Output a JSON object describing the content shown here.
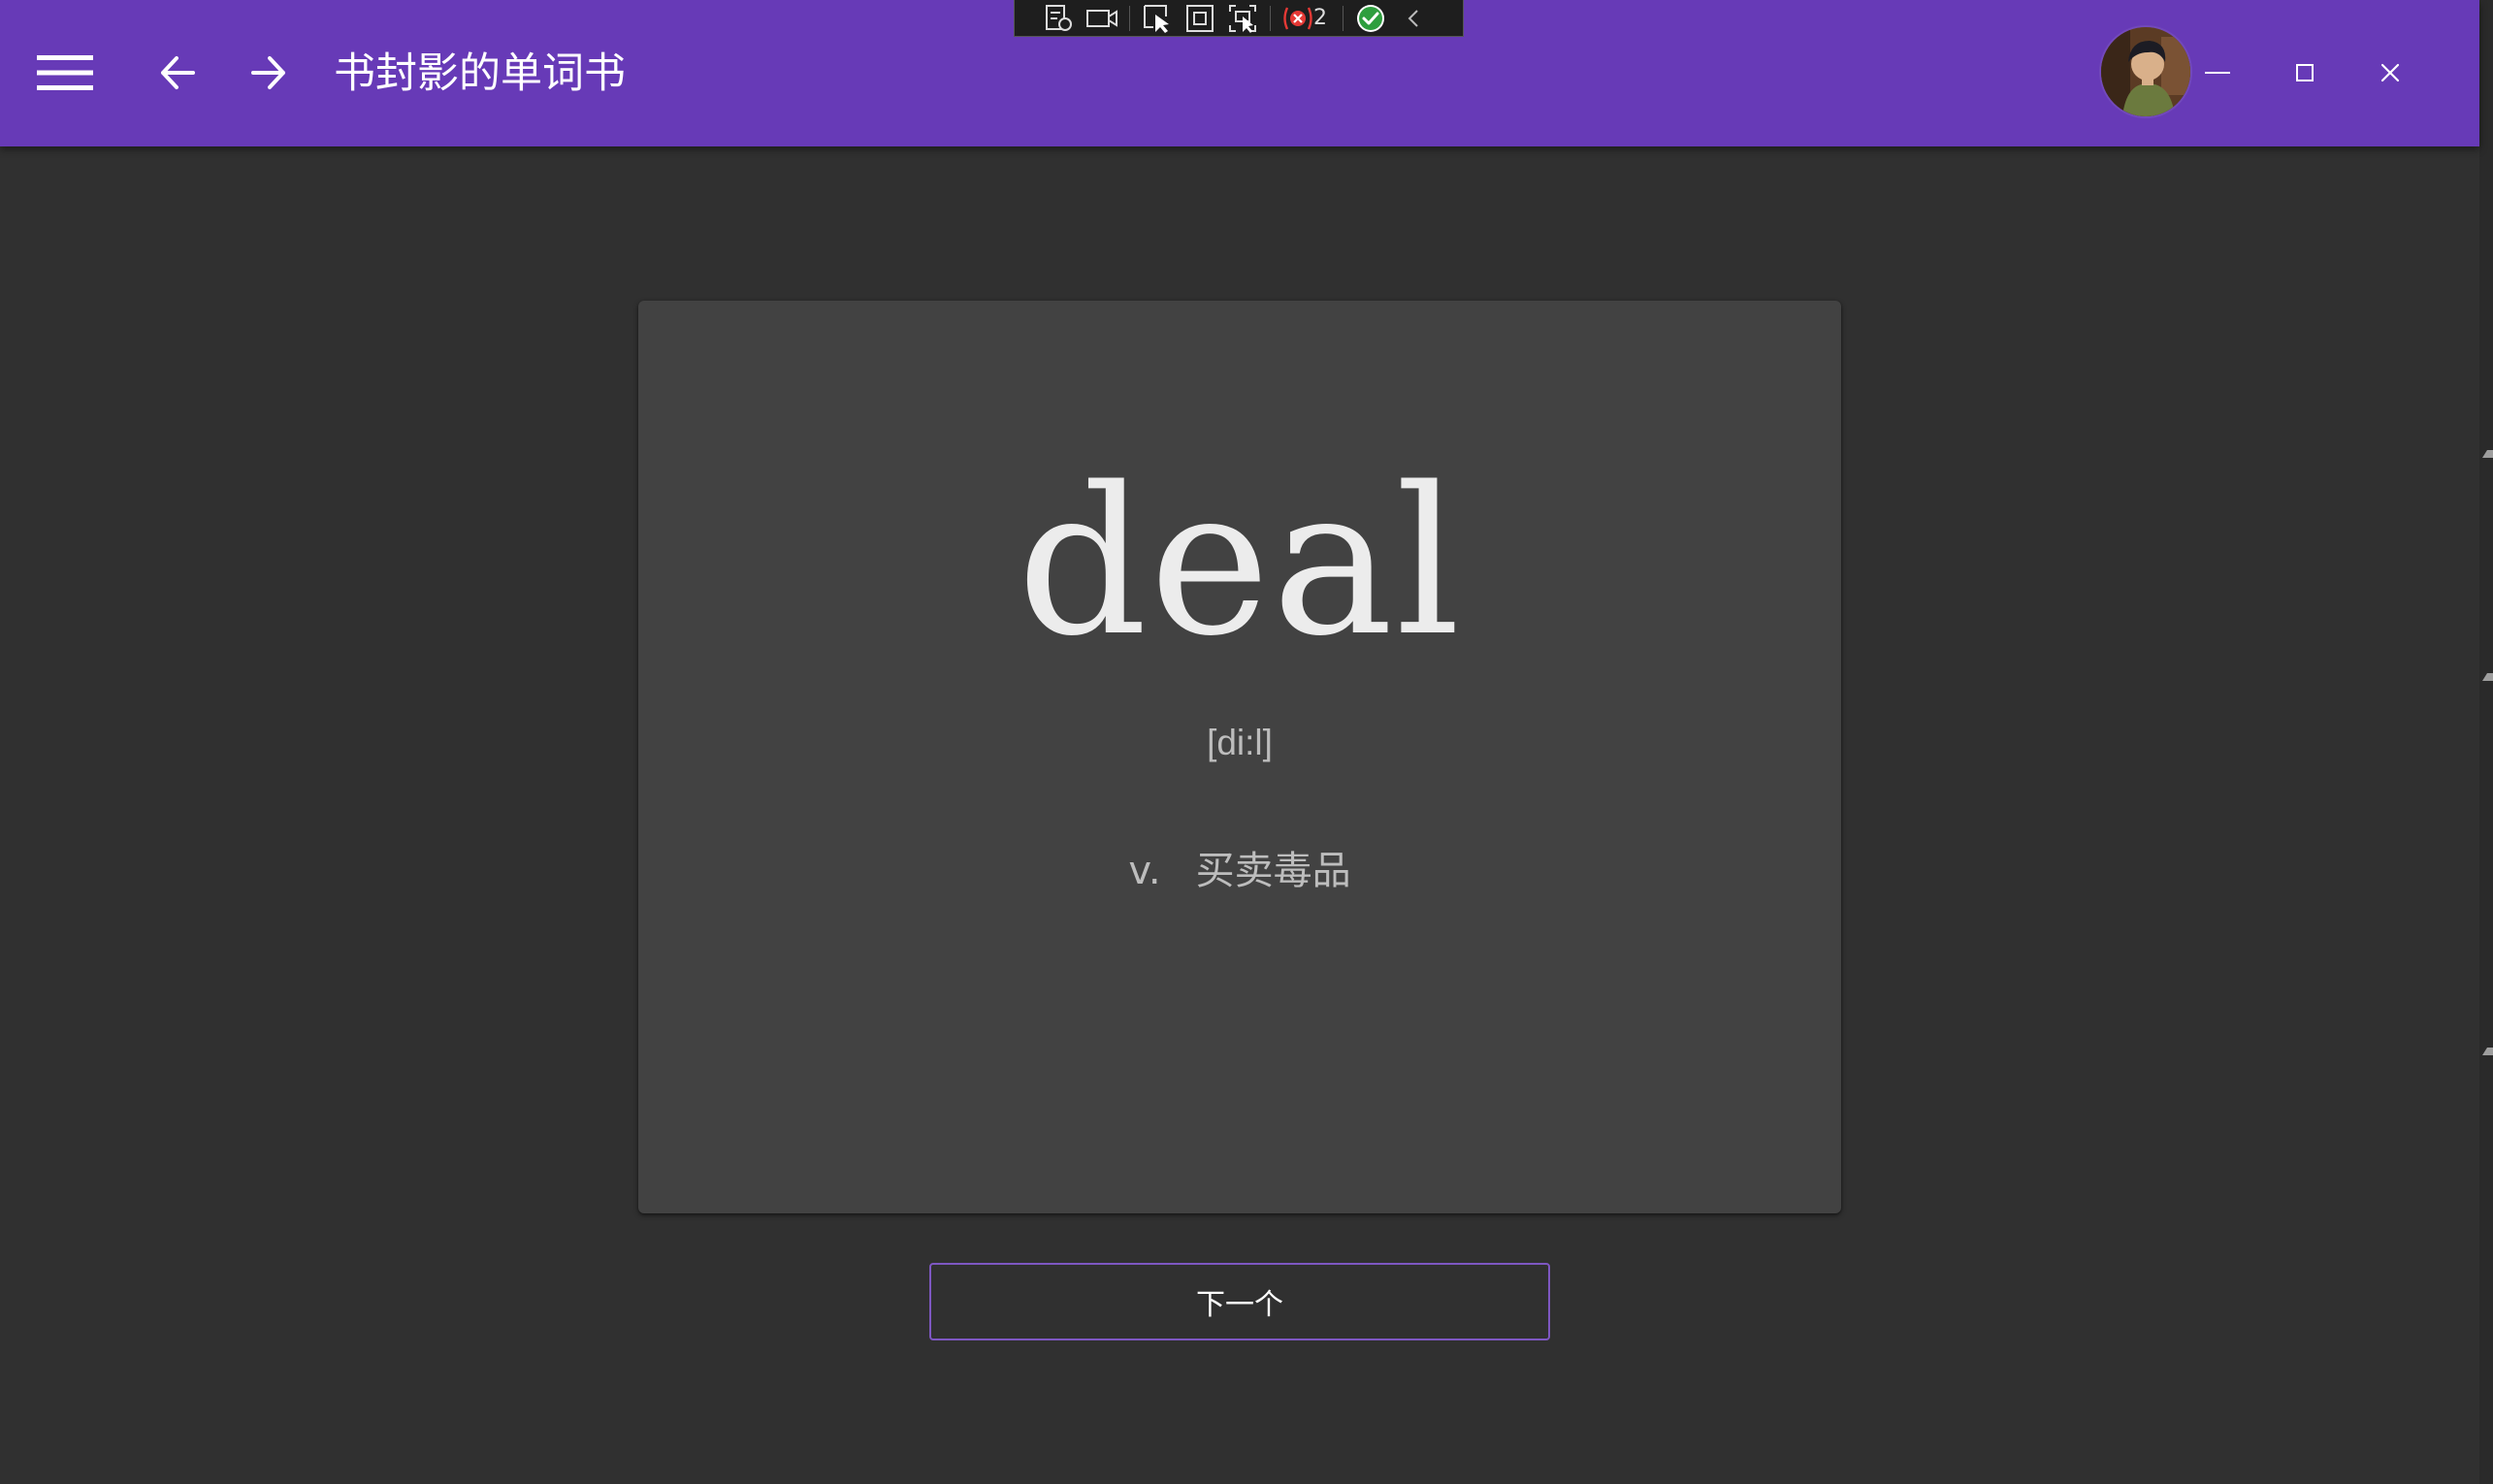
{
  "window": {
    "title": "书封影的单词书",
    "colors": {
      "titlebar": "#673ab7",
      "background": "#303030",
      "card": "#424242",
      "button_border": "#7e57c2"
    }
  },
  "titlebar": {
    "menu_icon": "hamburger-menu-icon",
    "back_icon": "arrow-left-icon",
    "forward_icon": "arrow-right-icon",
    "avatar": "user-avatar",
    "minimize_icon": "minimize-icon",
    "maximize_icon": "maximize-icon",
    "close_icon": "close-icon"
  },
  "debug_toolbar": {
    "icons": [
      "live-visual-tree-icon",
      "video-record-icon",
      "select-element-icon",
      "display-layout-adorners-icon",
      "track-focus-icon",
      "binding-failures-icon",
      "check-icon",
      "collapse-chevron-icon"
    ],
    "binding_failures_count": "2"
  },
  "card": {
    "word": "deal",
    "phonetic": "[di:l]",
    "part_of_speech": "v.",
    "meaning": "买卖毒品"
  },
  "actions": {
    "next_label": "下一个"
  }
}
